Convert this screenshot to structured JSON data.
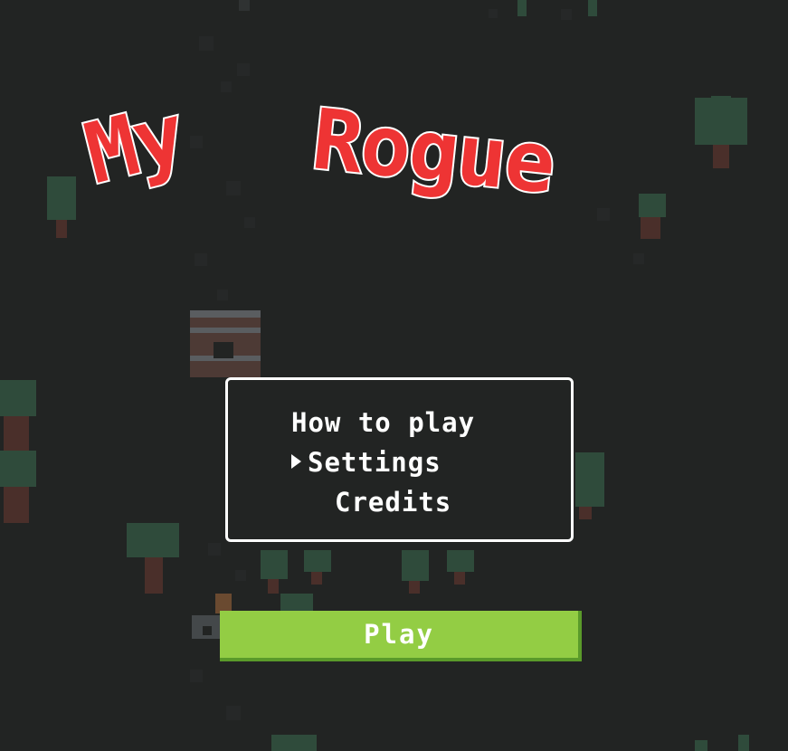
{
  "title": {
    "word1": "My",
    "word2": "Rogue",
    "color": "#ee3434",
    "outline_color": "#ffffff"
  },
  "menu": {
    "items": [
      {
        "label": "How to play",
        "selected": false
      },
      {
        "label": "Settings",
        "selected": true
      },
      {
        "label": "Credits",
        "selected": false
      }
    ]
  },
  "play_button": {
    "label": "Play",
    "color": "#93cd44"
  },
  "background": {
    "color": "#222423"
  }
}
